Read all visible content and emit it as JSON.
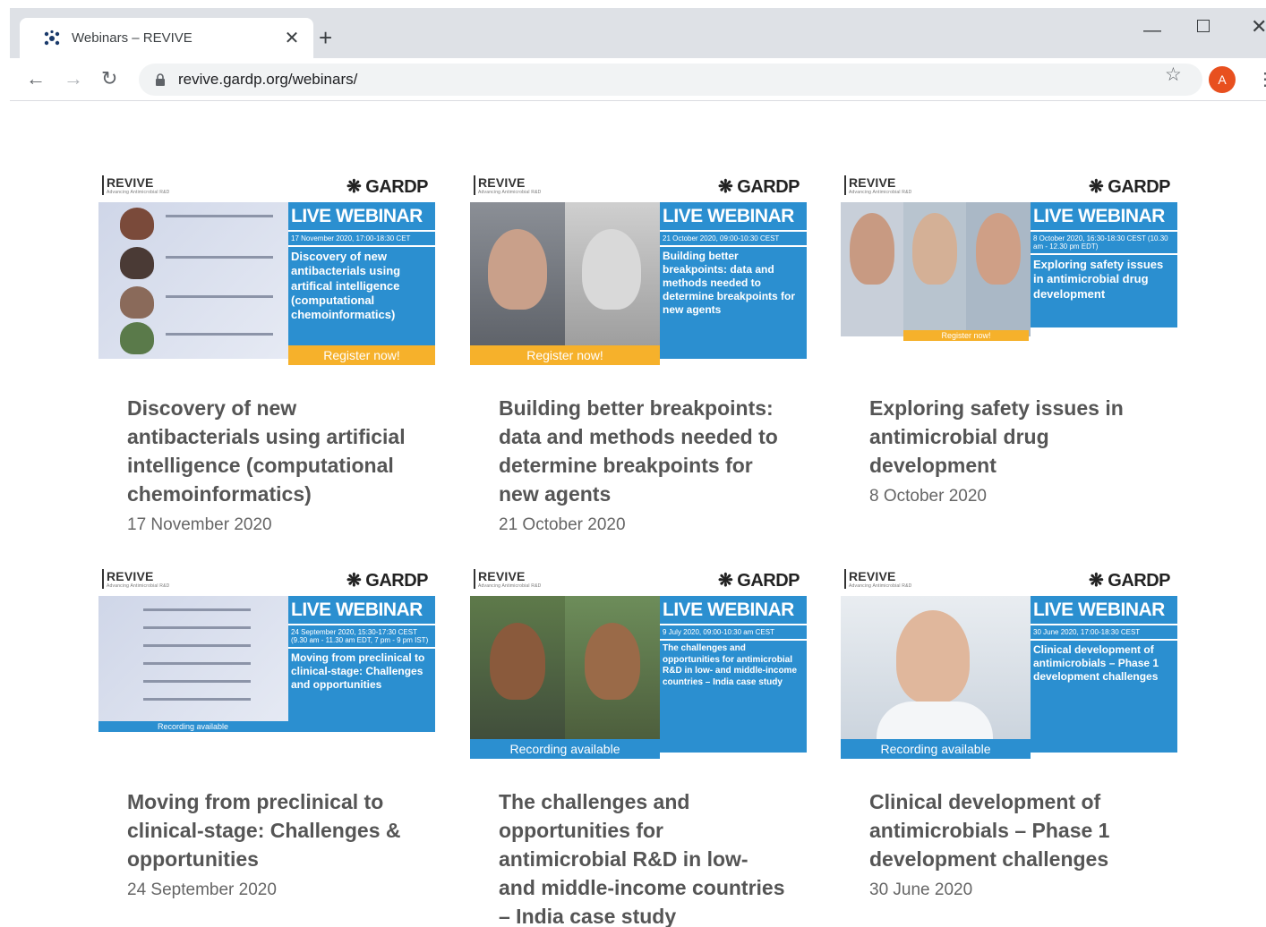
{
  "browser": {
    "tab_title": "Webinars – REVIVE",
    "url": "revive.gardp.org/webinars/",
    "avatar_letter": "A"
  },
  "webinars": [
    {
      "badge": "LIVE WEBINAR",
      "when": "17 November 2020, 17:00-18:30 CET",
      "topic": "Discovery of new antibacterials using artifical intelligence (computational chemoinformatics)",
      "banner": "Register now!",
      "title": "Discovery of new antibacterials using artificial intelligence (computational chemoinformatics)",
      "date": "17 November 2020"
    },
    {
      "badge": "LIVE WEBINAR",
      "when": "21 October 2020, 09:00-10:30 CEST",
      "topic": "Building better breakpoints: data and methods needed to determine breakpoints for new agents",
      "banner": "Register now!",
      "title": "Building better breakpoints: data and methods needed to determine breakpoints for new agents",
      "date": "21 October 2020"
    },
    {
      "badge": "LIVE WEBINAR",
      "when": "8 October 2020, 16:30-18:30 CEST (10.30 am - 12.30 pm EDT)",
      "topic": "Exploring safety issues in antimicrobial drug development",
      "banner": "Register now!",
      "title": "Exploring safety issues in antimicrobial drug development",
      "date": "8 October 2020"
    },
    {
      "badge": "LIVE WEBINAR",
      "when": "24 September 2020, 15:30-17:30 CEST (9.30 am - 11.30 am EDT, 7 pm - 9 pm IST)",
      "topic": "Moving from preclinical to clinical-stage: Challenges and opportunities",
      "banner": "Recording available",
      "title": "Moving from preclinical to clinical-stage: Challenges & opportunities",
      "date": "24 September 2020"
    },
    {
      "badge": "LIVE WEBINAR",
      "when": "9 July 2020, 09:00-10:30 am CEST",
      "topic": "The challenges and opportunities for antimicrobial R&D in low- and middle-income countries – India case study",
      "banner": "Recording available",
      "title": "The challenges and opportunities for antimicrobial R&D in low- and middle-income countries – India case study",
      "date": ""
    },
    {
      "badge": "LIVE WEBINAR",
      "when": "30 June 2020, 17:00-18:30 CEST",
      "topic": "Clinical development of antimicrobials – Phase 1 development challenges",
      "banner": "Recording available",
      "title": "Clinical development of antimicrobials – Phase 1 development challenges",
      "date": "30 June 2020"
    }
  ],
  "brand": {
    "revive": "REVIVE",
    "gardp": "GARDP"
  },
  "colors": {
    "accent_blue": "#2b8fd0",
    "register_yellow": "#f6b12b",
    "avatar": "#e8501f"
  }
}
